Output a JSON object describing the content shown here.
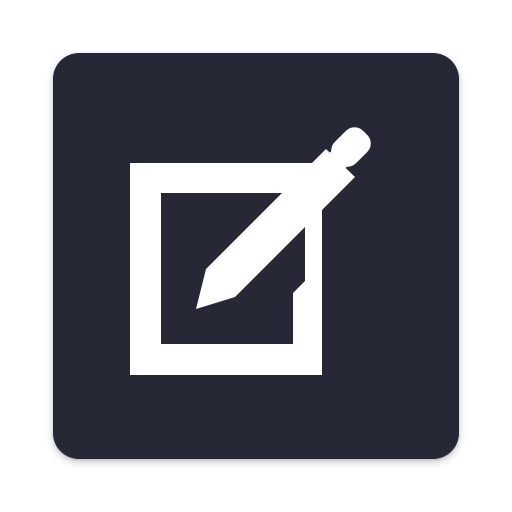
{
  "app_icon": {
    "name": "edit-icon",
    "background_color": "#262835",
    "glyph_color": "#ffffff",
    "glyphs": [
      "square-outline-icon",
      "pencil-icon"
    ]
  }
}
